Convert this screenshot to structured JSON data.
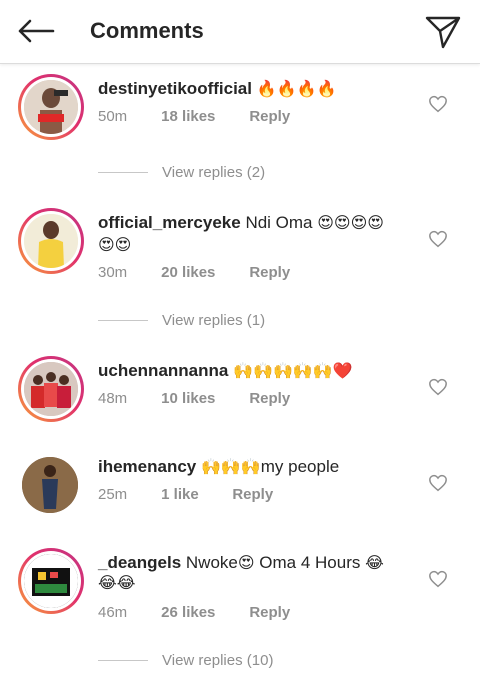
{
  "header": {
    "title": "Comments",
    "back_icon": "arrow-left-icon",
    "share_icon": "paper-plane-icon"
  },
  "comments": [
    {
      "username": "destinyetikoofficial",
      "text": "",
      "emoji": "🔥🔥🔥🔥",
      "time": "50m",
      "likes": "18 likes",
      "reply": "Reply",
      "view_replies": "View replies (2)"
    },
    {
      "username": "official_mercyeke",
      "text": "Ndi Oma",
      "emoji": "😍😍😍😍",
      "emoji_line2": "😍😍",
      "time": "30m",
      "likes": "20 likes",
      "reply": "Reply",
      "view_replies": "View replies (1)"
    },
    {
      "username": "uchennannanna",
      "text": "",
      "emoji": "🙌🙌🙌🙌🙌❤️",
      "time": "48m",
      "likes": "10 likes",
      "reply": "Reply"
    },
    {
      "username": "ihemenancy",
      "emoji": "🙌🙌🙌",
      "text": "my people",
      "time": "25m",
      "likes": "1 like",
      "reply": "Reply"
    },
    {
      "username": "_deangels",
      "text": "Nwoke",
      "emoji": "😍",
      "text2": "Oma 4 Hours",
      "emoji2": "😂",
      "emoji_line2": "😂😂",
      "time": "46m",
      "likes": "26 likes",
      "reply": "Reply",
      "view_replies": "View replies (10)"
    }
  ],
  "colors": {
    "ring_start": "#f9a13a",
    "ring_end": "#c13584",
    "muted": "#8e8e8e",
    "text": "#262626"
  }
}
